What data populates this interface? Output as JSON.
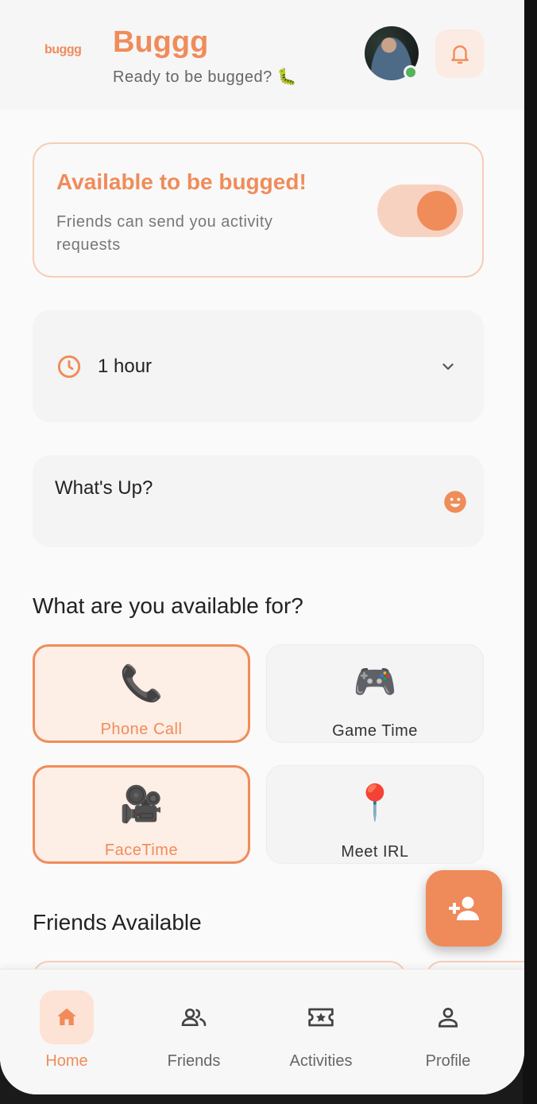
{
  "header": {
    "logo_text": "buggg",
    "title": "Buggg",
    "subtitle": "Ready to be bugged? 🐛",
    "avatar_icon": "user-avatar",
    "notification_icon": "bell-icon"
  },
  "availability": {
    "title": "Available to be bugged!",
    "description": "Friends can send you activity requests",
    "toggle_on": true
  },
  "duration": {
    "icon": "clock-icon",
    "value": "1 hour"
  },
  "status": {
    "placeholder": "What's Up?",
    "emoji_icon": "smiley-icon"
  },
  "activities": {
    "heading": "What are you available for?",
    "items": [
      {
        "label": "Phone Call",
        "emoji": "📞",
        "selected": true
      },
      {
        "label": "Game Time",
        "emoji": "🎮",
        "selected": false
      },
      {
        "label": "FaceTime",
        "emoji": "🎥",
        "selected": true
      },
      {
        "label": "Meet IRL",
        "emoji": "📍",
        "selected": false
      }
    ]
  },
  "friends": {
    "heading": "Friends Available"
  },
  "fab": {
    "icon": "add-person-icon"
  },
  "nav": {
    "items": [
      {
        "label": "Home",
        "icon": "home-icon",
        "active": true
      },
      {
        "label": "Friends",
        "icon": "friends-icon",
        "active": false
      },
      {
        "label": "Activities",
        "icon": "activities-icon",
        "active": false
      },
      {
        "label": "Profile",
        "icon": "profile-icon",
        "active": false
      }
    ]
  },
  "colors": {
    "accent": "#f08c5a",
    "accent_light": "#fdeee6",
    "online": "#55b35a"
  }
}
